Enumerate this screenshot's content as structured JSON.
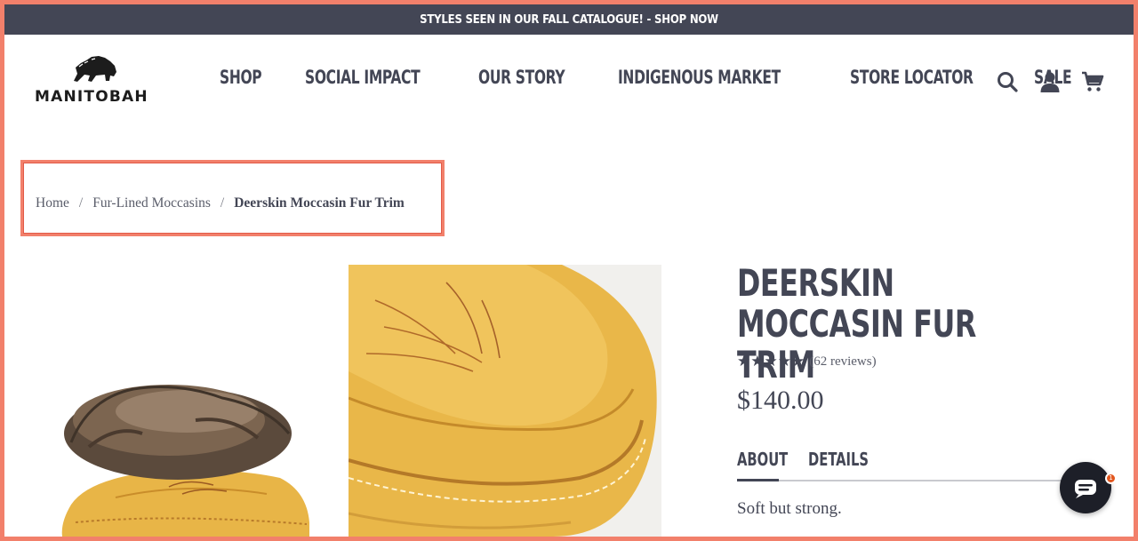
{
  "announcement": "STYLES SEEN IN OUR FALL CATALOGUE! - SHOP NOW",
  "brand": {
    "logo_text": "MANITOBAH"
  },
  "nav": [
    {
      "label": "SHOP"
    },
    {
      "label": "SOCIAL IMPACT"
    },
    {
      "label": "OUR STORY"
    },
    {
      "label": "INDIGENOUS MARKET"
    },
    {
      "label": "STORE LOCATOR"
    },
    {
      "label": "SALE"
    }
  ],
  "header_icons": [
    "search-icon",
    "account-icon",
    "cart-icon"
  ],
  "breadcrumb": {
    "home": "Home",
    "separator": "/",
    "category": "Fur-Lined Moccasins",
    "current": "Deerskin Moccasin Fur Trim"
  },
  "product": {
    "title": "DEERSKIN MOCCASIN FUR TRIM",
    "stars": "★★★★★",
    "reviews": "(62 reviews)",
    "price": "$140.00",
    "tabs": [
      {
        "label": "ABOUT"
      },
      {
        "label": "DETAILS"
      }
    ],
    "about_text": "Soft but strong."
  },
  "chat": {
    "badge": "1",
    "icon": "chat-icon"
  },
  "colors": {
    "accent": "#f2806b",
    "text": "#434655",
    "topbar": "#434655",
    "leather": "#e8b547"
  }
}
